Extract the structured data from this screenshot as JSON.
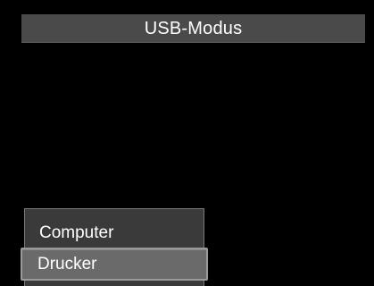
{
  "header": {
    "title": "USB-Modus"
  },
  "menu": {
    "items": [
      {
        "label": "Computer",
        "selected": false
      },
      {
        "label": "Drucker",
        "selected": true
      }
    ]
  },
  "colors": {
    "background": "#000000",
    "title_bar": "#4a4a4a",
    "menu_background": "#3a3a3a",
    "selected_item": "#6a6a6a",
    "text": "#ffffff"
  }
}
